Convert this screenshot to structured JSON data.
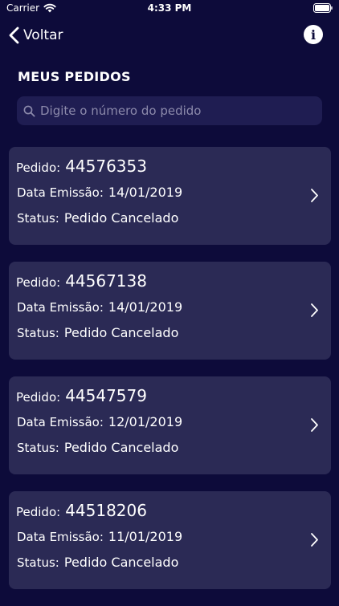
{
  "status_bar": {
    "carrier": "Carrier",
    "time": "4:33 PM"
  },
  "nav": {
    "back_label": "Voltar",
    "info_icon": "info-icon"
  },
  "page": {
    "title": "MEUS PEDIDOS"
  },
  "search": {
    "placeholder": "Digite o número do pedido",
    "value": ""
  },
  "labels": {
    "order": "Pedido:",
    "date": "Data Emissão:",
    "status": "Status:"
  },
  "orders": [
    {
      "number": "44576353",
      "date": "14/01/2019",
      "status": "Pedido Cancelado"
    },
    {
      "number": "44567138",
      "date": "14/01/2019",
      "status": "Pedido Cancelado"
    },
    {
      "number": "44547579",
      "date": "12/01/2019",
      "status": "Pedido Cancelado"
    },
    {
      "number": "44518206",
      "date": "11/01/2019",
      "status": "Pedido Cancelado"
    }
  ],
  "colors": {
    "background": "#0d0b3a",
    "card": "#2b2a55",
    "search_field": "#1f1d52",
    "text": "#ffffff"
  }
}
